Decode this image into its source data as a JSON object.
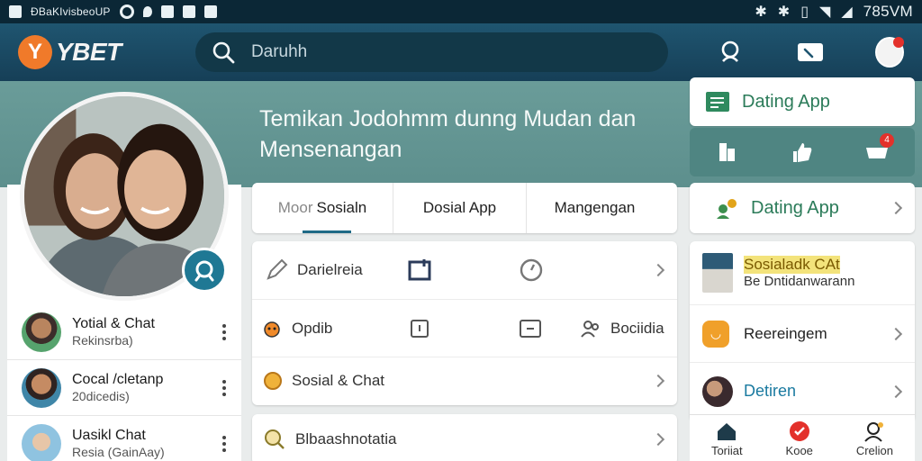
{
  "status_bar": {
    "app_text": "ĐBaKIvisbeoUP",
    "time": "785VM"
  },
  "header": {
    "logo_y": "Y",
    "logo_text": "YBET",
    "search": {
      "placeholder": "Daruhh"
    }
  },
  "hero": {
    "headline": "Temikan Jodohmm dunng Mudan dan Mensenangan"
  },
  "tabs": [
    {
      "prefix": "Moor",
      "label": "Sosialn"
    },
    {
      "prefix": "",
      "label": "Dosial App"
    },
    {
      "prefix": "",
      "label": "Mangengan"
    }
  ],
  "menu_grid": {
    "row1": {
      "item1": "Darielreia"
    },
    "row2": {
      "item1": "Opdib",
      "item4": "Bociidia"
    },
    "row3": {
      "item1": "Sosial & Chat"
    }
  },
  "menu_card2": {
    "label": "Blbaashnotatia"
  },
  "contacts": [
    {
      "name": "Yotial & Chat",
      "sub": "Rekinsrba)"
    },
    {
      "name": "Cocal /cletanp",
      "sub": "20dicedis)"
    },
    {
      "name": "Uasikl Chat",
      "sub": "Resia (GainAay)"
    }
  ],
  "right_panel": {
    "top_card_title": "Dating App",
    "quick_actions_badge": "4",
    "dating_row": "Dating App",
    "list": [
      {
        "title": "Sosialadk CAt",
        "sub": "Be Dntidanwarann"
      },
      {
        "title": "Reereingem",
        "sub": ""
      },
      {
        "title": "Detiren",
        "sub": ""
      }
    ],
    "bottom_nav": [
      "Toriiat",
      "Kooe",
      "Crelion"
    ]
  },
  "colors": {
    "header": "#1f5570",
    "hero": "#6a9c99",
    "accent_green": "#2b7b59",
    "brand_red": "#e3312b",
    "brand_orange": "#f07a2a"
  }
}
